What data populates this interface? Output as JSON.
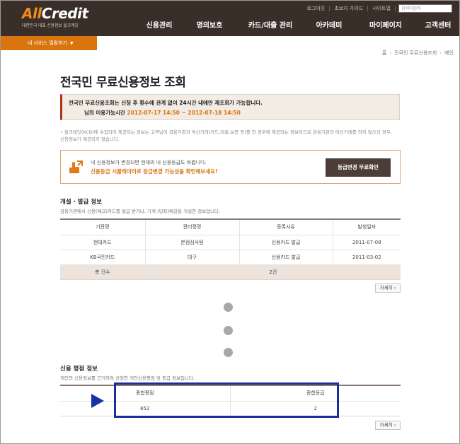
{
  "brand": {
    "logo_a": "All",
    "logo_b": "Credit",
    "tagline": "대한민국 대표 신용정보 올크레딧"
  },
  "util_links": [
    "로그아웃",
    "초보자 가이드",
    "사이트맵"
  ],
  "search_placeholder": "검색어입력",
  "gnb": [
    "신용관리",
    "명의보호",
    "카드/대출 관리",
    "아카데미",
    "마이페이지",
    "고객센터"
  ],
  "service_button": "내 서비스 열람하기",
  "breadcrumb": [
    "홈",
    "전국민 무료신용조회",
    "메인"
  ],
  "page_title": "전국민 무료신용정보 조회",
  "notice": {
    "line1": "전국민 무료신용조회는 신청 후 횟수에 관계 없이 24시간 내에만 재조회가 가능합니다.",
    "line2_label": "님의 이용가능시간",
    "line2_time": "2012-07-17 14:50 ~ 2012-07-18 14:50"
  },
  "bullet_text": "올크레딧(KCB)에 수집되어 제공되는 정보는 고객님이 금융기관과 여신거래(카드,대출,보증 등)를 한 경우에 제공되는 정보이므로 금융기관과 여신거래를 하지 않으신 경우, 신용정보가 제공되지 않습니다.",
  "promo": {
    "line1": "내 신용정보가 변경되면 현재의 내 신용등급도 바뀝니다.",
    "line2": "신용등급 시뮬레이터로 등급변경 가능성을 확인해보세요!",
    "button": "등급변경 무료확인"
  },
  "card_section": {
    "title": "개설 · 발급 정보",
    "desc": "금융기관에서 신용(체크)카드를 발급 받거나, 가계 (당좌)예금을 개설한 정보입니다.",
    "columns": [
      "기관명",
      "관리정명",
      "등록사유",
      "발생일자"
    ],
    "rows": [
      [
        "현대카드",
        "본점심사팀",
        "신용카드 발급",
        "2011-07-08"
      ],
      [
        "KB국민카드",
        "대구",
        "신용카드 발급",
        "2011-03-02"
      ]
    ],
    "total_label": "총 건수",
    "total_value": "2건",
    "more": "자세히"
  },
  "rating_section": {
    "title": "신용 평점 정보",
    "desc": "개인의 신용정보를 근거하여 산정한 개인신용평점 및 등급 정보입니다.",
    "columns": [
      "종합평점",
      "종합등급"
    ],
    "score": "652",
    "grade": "2",
    "more": "자세히"
  },
  "colors": {
    "header_bg": "#3a2e29",
    "accent_orange": "#d9740f",
    "highlight_blue": "#1a2e9c"
  }
}
